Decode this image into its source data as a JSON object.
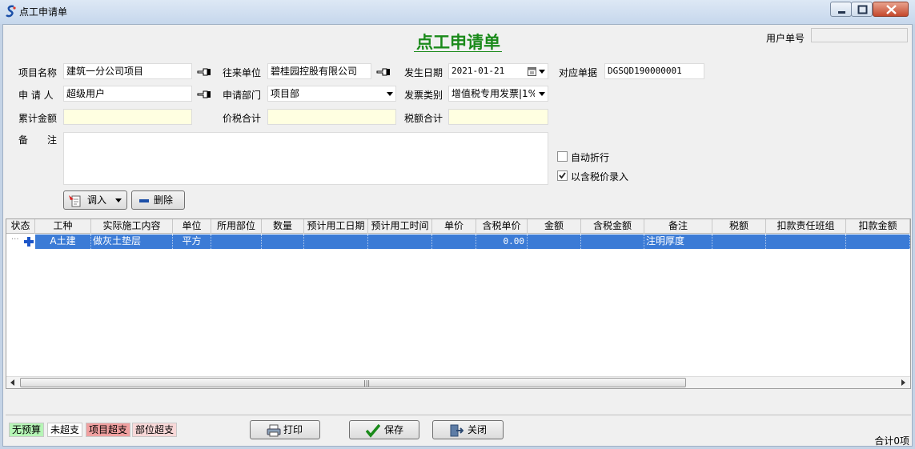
{
  "window": {
    "title": "点工申请单"
  },
  "form": {
    "heading": "点工申请单",
    "user_no_label": "用户单号",
    "user_no_value": "",
    "project_name_label": "项目名称",
    "project_name_value": "建筑一分公司项目",
    "partner_label": "往来单位",
    "partner_value": "碧桂园控股有限公司",
    "date_label": "发生日期",
    "date_value": "2021-01-21",
    "ref_doc_label": "对应单据",
    "ref_doc_value": "DGSQD190000001",
    "applicant_label": "申 请 人",
    "applicant_value": "超级用户",
    "dept_label": "申请部门",
    "dept_value": "项目部",
    "invoice_type_label": "发票类别",
    "invoice_type_value": "增值税专用发票|1%",
    "cumulative_label": "累计金额",
    "cumulative_value": "",
    "price_tax_total_label": "价税合计",
    "price_tax_total_value": "",
    "tax_total_label": "税额合计",
    "tax_total_value": "",
    "remark_label": "备　　注",
    "remark_value": "",
    "auto_discount_label": "自动折行",
    "auto_discount_checked": false,
    "tax_inclusive_label": "以含税价录入",
    "tax_inclusive_checked": true,
    "import_button": "调入",
    "delete_button": "删除"
  },
  "grid": {
    "columns": [
      "状态",
      "工种",
      "实际施工内容",
      "单位",
      "所用部位",
      "数量",
      "预计用工日期",
      "预计用工时间",
      "单价",
      "含税单价",
      "金额",
      "含税金额",
      "备注",
      "税额",
      "扣款责任班组",
      "扣款金额"
    ],
    "rows": [
      {
        "status": "",
        "work_type": "A土建",
        "content": "做灰土垫层",
        "unit": "平方",
        "location": "",
        "quantity": "",
        "date": "",
        "time": "",
        "price": "",
        "tax_price": "0.00",
        "amount": "",
        "tax_amount": "",
        "remark": "注明厚度",
        "tax": "",
        "team": "",
        "deduct": ""
      }
    ]
  },
  "legend": [
    "无预算",
    "未超支",
    "项目超支",
    "部位超支"
  ],
  "legend_colors": [
    "#b6f5b6",
    "#ffffff",
    "#f0a0a0",
    "#f8d8d8"
  ],
  "buttons": {
    "print": "打印",
    "save": "保存",
    "close": "关闭"
  },
  "summary": "合计0项"
}
